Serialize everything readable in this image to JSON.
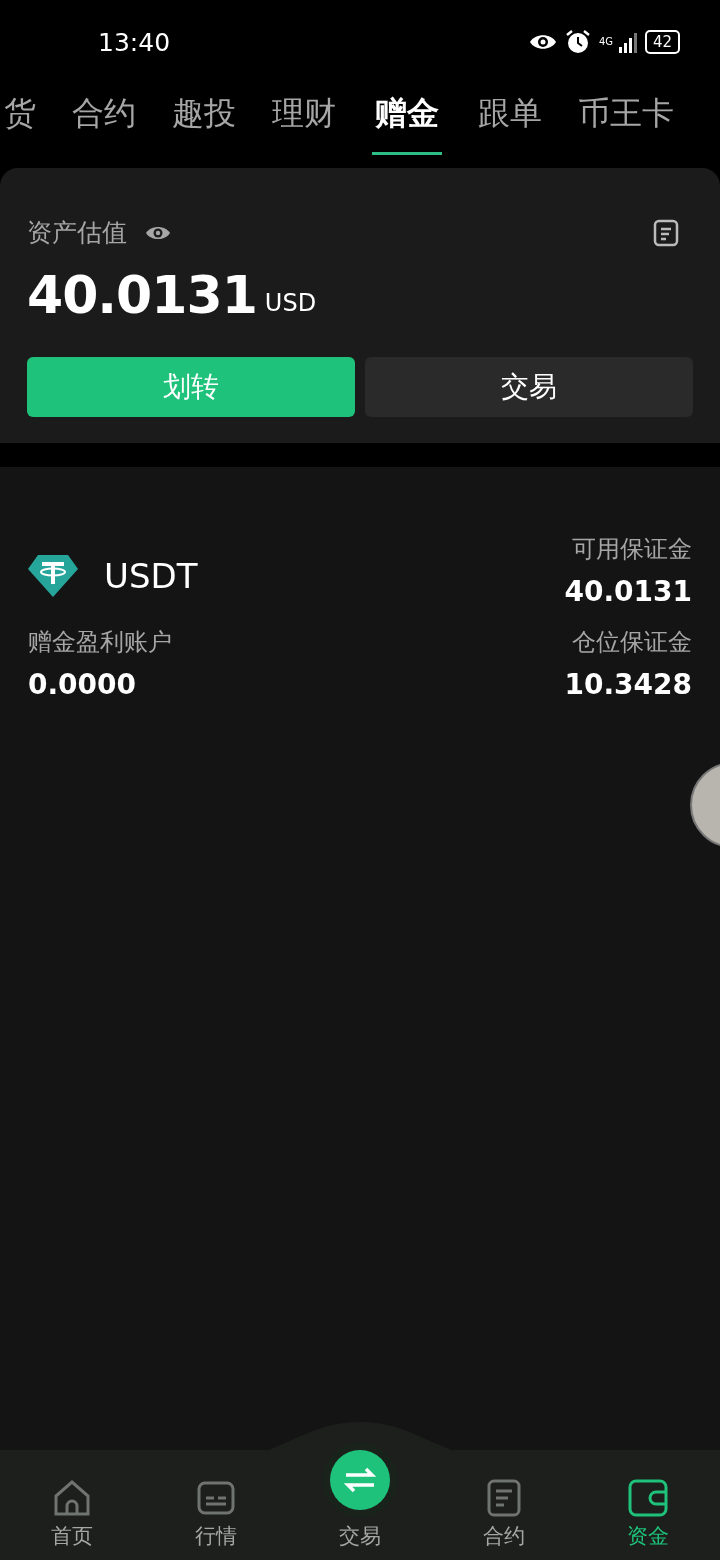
{
  "status_bar": {
    "time": "13:40",
    "network": "4G",
    "battery": "42"
  },
  "tabs": [
    {
      "label": "货",
      "selected": false
    },
    {
      "label": "合约",
      "selected": false
    },
    {
      "label": "趣投",
      "selected": false
    },
    {
      "label": "理财",
      "selected": false
    },
    {
      "label": "赠金",
      "selected": true
    },
    {
      "label": "跟单",
      "selected": false
    },
    {
      "label": "币王卡",
      "selected": false
    }
  ],
  "summary": {
    "title": "资产估值",
    "amount": "40.0131",
    "unit": "USD",
    "buttons": [
      {
        "label": "划转",
        "kind": "primary"
      },
      {
        "label": "交易",
        "kind": "secondary"
      }
    ]
  },
  "asset": {
    "name": "USDT",
    "stats": [
      {
        "label": "可用保证金",
        "value": "40.0131"
      },
      {
        "label": "赠金盈利账户",
        "value": "0.0000"
      },
      {
        "label": "仓位保证金",
        "value": "10.3428"
      }
    ]
  },
  "bottom_nav": [
    {
      "label": "首页",
      "kind": "home",
      "selected": false
    },
    {
      "label": "行情",
      "kind": "market",
      "selected": false
    },
    {
      "label": "交易",
      "kind": "trade",
      "selected": false
    },
    {
      "label": "合约",
      "kind": "doc",
      "selected": false
    },
    {
      "label": "资金",
      "kind": "wallet",
      "selected": true
    }
  ]
}
